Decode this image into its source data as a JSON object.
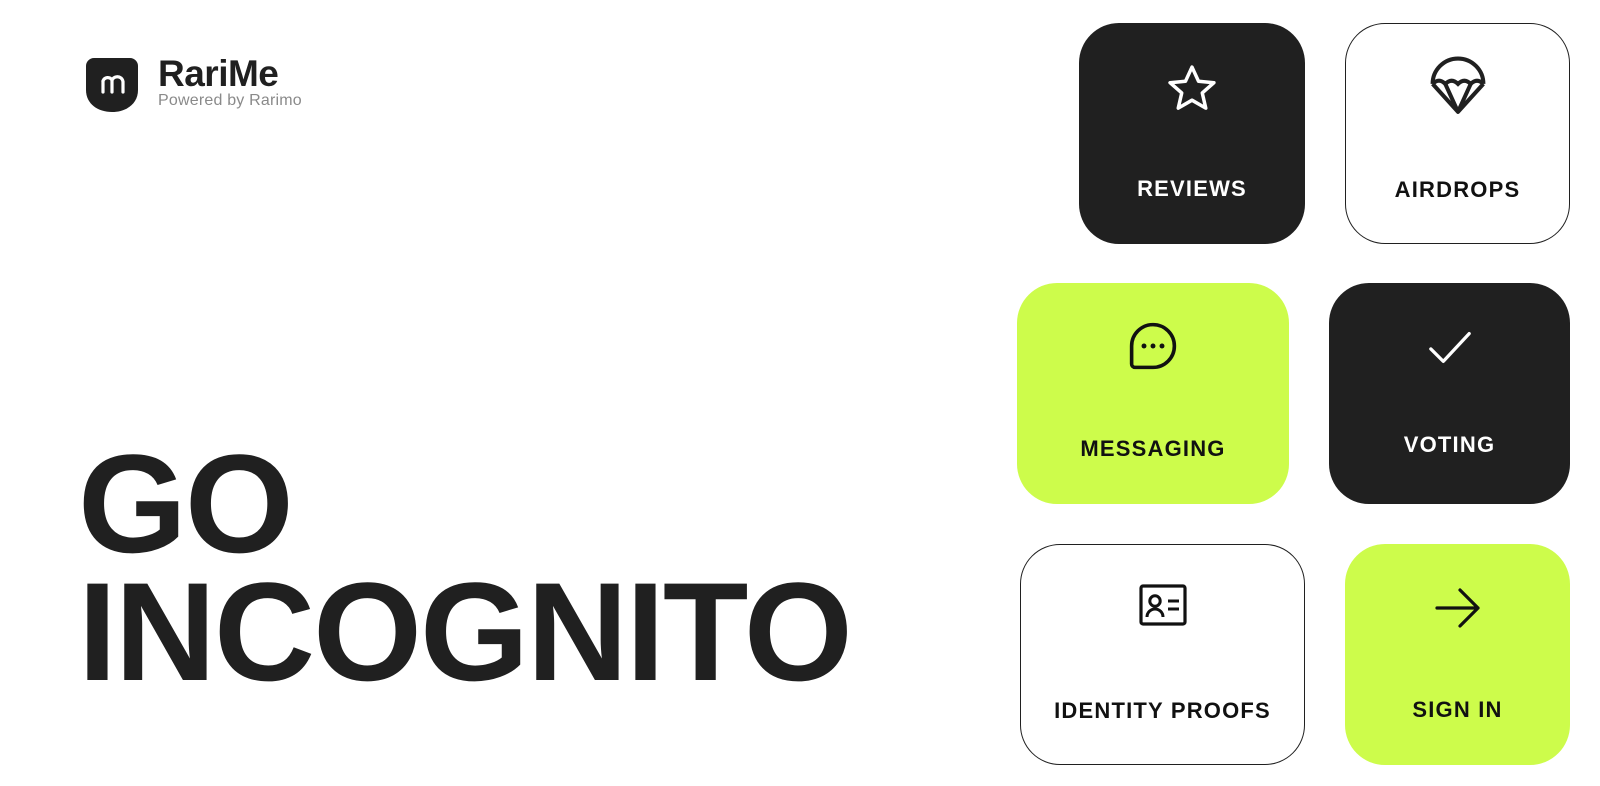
{
  "brand": {
    "name": "RariMe",
    "subtitle": "Powered by Rarimo",
    "logo_icon": "rarime-shield-logo"
  },
  "headline": {
    "line1": "GO",
    "line2": "INCOGNITO"
  },
  "tiles": [
    {
      "label": "REVIEWS",
      "icon": "star-icon",
      "style": "dark"
    },
    {
      "label": "AIRDROPS",
      "icon": "parachute-icon",
      "style": "outline"
    },
    {
      "label": "MESSAGING",
      "icon": "chat-bubble-icon",
      "style": "lime"
    },
    {
      "label": "VOTING",
      "icon": "check-icon",
      "style": "dark"
    },
    {
      "label": "IDENTITY PROOFS",
      "icon": "id-card-icon",
      "style": "outline"
    },
    {
      "label": "SIGN IN",
      "icon": "arrow-right-icon",
      "style": "lime"
    }
  ],
  "colors": {
    "dark": "#202020",
    "lime": "#cdfc4b",
    "white": "#ffffff",
    "muted": "#8a8a8a"
  }
}
